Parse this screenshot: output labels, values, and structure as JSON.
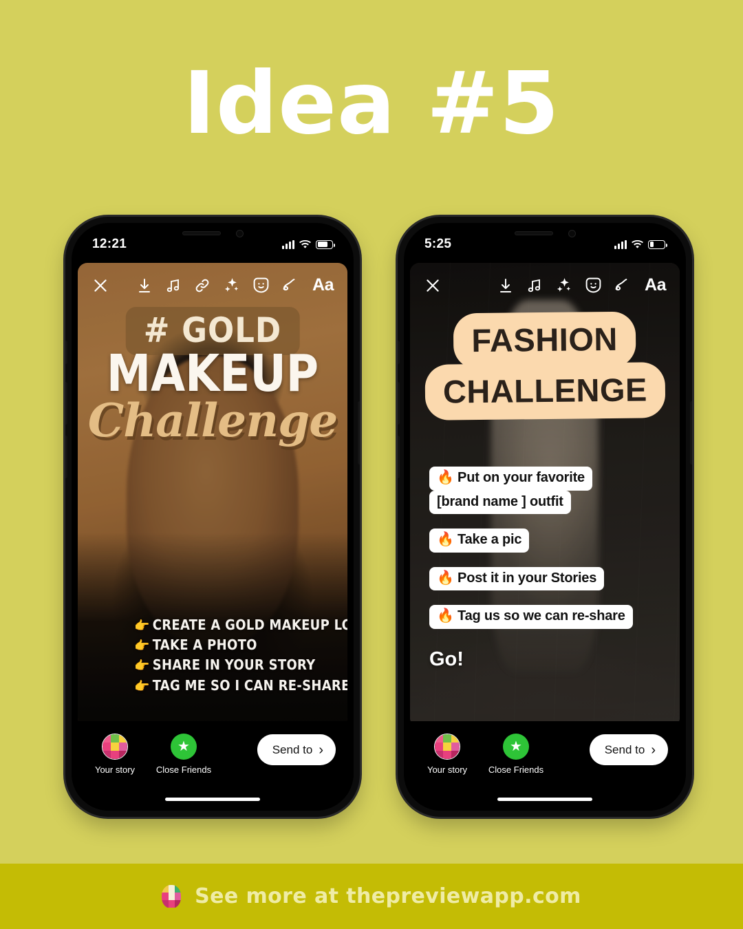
{
  "header": {
    "title": "Idea #5"
  },
  "footer": {
    "text": "See more at thepreviewapp.com",
    "logo_icon": "preview-app-grid-logo",
    "band_color": "#c4bc05",
    "text_color": "#efeca6"
  },
  "background_color": "#d4d05c",
  "phones": [
    {
      "id": "left",
      "status": {
        "time": "12:21",
        "signal_icon": "cellular-bars-icon",
        "wifi_icon": "wifi-icon",
        "battery_icon": "battery-icon",
        "battery_level": 72
      },
      "toolbar": [
        {
          "name": "close-icon",
          "label": "Close"
        },
        {
          "name": "download-icon",
          "label": "Save"
        },
        {
          "name": "music-note-icon",
          "label": "Music"
        },
        {
          "name": "link-icon",
          "label": "Link"
        },
        {
          "name": "sparkles-icon",
          "label": "Effects"
        },
        {
          "name": "sticker-icon",
          "label": "Stickers"
        },
        {
          "name": "draw-squiggle-icon",
          "label": "Draw"
        },
        {
          "name": "text-aa-icon",
          "label": "Aa"
        }
      ],
      "story": {
        "type": "gold-makeup-portrait",
        "tag": "# GOLD",
        "headline": "MAKEUP",
        "script_word": "Challenge",
        "steps": [
          "CREATE A GOLD MAKEUP LOOK",
          "TAKE A PHOTO",
          "SHARE IN YOUR STORY",
          "TAG ME SO I CAN RE-SHARE"
        ],
        "step_bullet": "👉",
        "tag_bg_color": "#78552d",
        "tag_text_color": "#f4e8d2",
        "script_color": "#e4bd85"
      },
      "share": {
        "your_story_label": "Your story",
        "close_friends_label": "Close Friends",
        "close_friends_icon": "green-star-icon",
        "your_story_icon": "story-grid-avatar",
        "send_to_label": "Send to",
        "send_to_chevron": "chevron-right-icon"
      }
    },
    {
      "id": "right",
      "status": {
        "time": "5:25",
        "signal_icon": "cellular-bars-icon",
        "wifi_icon": "wifi-icon",
        "battery_icon": "battery-icon",
        "battery_level": 28
      },
      "toolbar": [
        {
          "name": "close-icon",
          "label": "Close"
        },
        {
          "name": "download-icon",
          "label": "Save"
        },
        {
          "name": "music-note-icon",
          "label": "Music"
        },
        {
          "name": "sparkles-icon",
          "label": "Effects"
        },
        {
          "name": "sticker-icon",
          "label": "Stickers"
        },
        {
          "name": "draw-squiggle-icon",
          "label": "Draw"
        },
        {
          "name": "text-aa-icon",
          "label": "Aa"
        }
      ],
      "story": {
        "type": "street-fashion-photo",
        "title_line1": "FASHION",
        "title_line2": "CHALLENGE",
        "title_bg_color": "#fbd9ae",
        "title_text_color": "#2a211a",
        "steps": [
          {
            "lines": [
              "🔥 Put on your favorite",
              "[brand name ] outfit"
            ]
          },
          {
            "lines": [
              "🔥 Take a pic"
            ]
          },
          {
            "lines": [
              "🔥 Post it in your Stories"
            ]
          },
          {
            "lines": [
              "🔥 Tag us so we can re-share"
            ]
          }
        ],
        "closing": "Go!"
      },
      "share": {
        "your_story_label": "Your story",
        "close_friends_label": "Close Friends",
        "close_friends_icon": "green-star-icon",
        "your_story_icon": "story-grid-avatar",
        "send_to_label": "Send to",
        "send_to_chevron": "chevron-right-icon"
      }
    }
  ]
}
